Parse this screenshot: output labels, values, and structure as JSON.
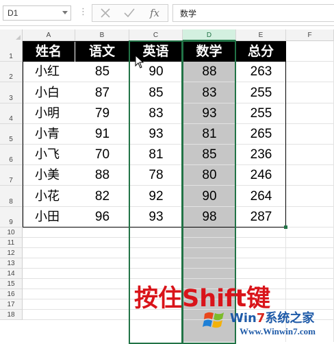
{
  "formula_bar": {
    "name_box": "D1",
    "dots": "⋮",
    "cancel_icon": "close-icon",
    "enter_icon": "check-icon",
    "fx_label": "fx",
    "formula": "数学"
  },
  "columns": [
    "A",
    "B",
    "C",
    "D",
    "E",
    "F"
  ],
  "rows": [
    "1",
    "2",
    "3",
    "4",
    "5",
    "6",
    "7",
    "8",
    "9",
    "10",
    "11",
    "12",
    "13",
    "14",
    "15",
    "16",
    "17",
    "18"
  ],
  "table": {
    "headers": [
      "姓名",
      "语文",
      "英语",
      "数学",
      "总分"
    ],
    "rows": [
      [
        "小红",
        "85",
        "90",
        "88",
        "263"
      ],
      [
        "小白",
        "87",
        "85",
        "83",
        "255"
      ],
      [
        "小明",
        "79",
        "83",
        "93",
        "255"
      ],
      [
        "小青",
        "91",
        "93",
        "81",
        "265"
      ],
      [
        "小飞",
        "70",
        "81",
        "85",
        "236"
      ],
      [
        "小美",
        "88",
        "78",
        "80",
        "246"
      ],
      [
        "小花",
        "82",
        "92",
        "90",
        "264"
      ],
      [
        "小田",
        "96",
        "93",
        "98",
        "287"
      ]
    ]
  },
  "overlay": {
    "text": "按住Shift键",
    "color": "#d9141a"
  },
  "watermark": {
    "title_pre": "Win",
    "title_seven": "7",
    "title_post": "系统之家",
    "url": "Www.Winwin7.com"
  },
  "colors": {
    "accent": "#217346",
    "header_bg": "#000000",
    "selected_col": "#c6c6c6"
  }
}
